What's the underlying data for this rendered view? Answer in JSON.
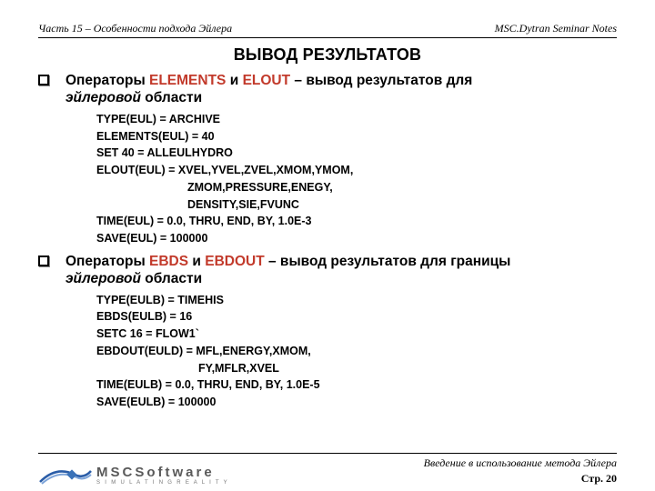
{
  "header": {
    "left": "Часть 15 – Особенности подхода Эйлера",
    "right": "MSC.Dytran Seminar Notes"
  },
  "title": "ВЫВОД РЕЗУЛЬТАТОВ",
  "section1": {
    "lead": "Операторы ",
    "kw1": "ELEMENTS",
    "mid": " и ",
    "kw2": "ELOUT",
    "tail1": " – вывод результатов для ",
    "tail2": "эйлеровой",
    "tail3": " области",
    "code": {
      "l1": "TYPE(EUL) = ARCHIVE",
      "l2": "ELEMENTS(EUL) = 40",
      "l3": "SET 40 = ALLEULHYDRO",
      "l4": "ELOUT(EUL) = XVEL,YVEL,ZVEL,XMOM,YMOM,",
      "l5": "ZMOM,PRESSURE,ENEGY,",
      "l6": "DENSITY,SIE,FVUNC",
      "l7": "TIME(EUL) = 0.0, THRU, END, BY, 1.0E-3",
      "l8": "SAVE(EUL) = 100000"
    }
  },
  "section2": {
    "lead": "Операторы ",
    "kw1": "EBDS",
    "mid": " и ",
    "kw2": "EBDOUT",
    "tail1": " – вывод результатов для границы ",
    "tail2": "эйлеровой",
    "tail3": " области",
    "code": {
      "l1": "TYPE(EULB) = TIMEHIS",
      "l2": "EBDS(EULB) = 16",
      "l3": "SETC 16 = FLOW1`",
      "l4": "EBDOUT(EULD) = MFL,ENERGY,XMOM,",
      "l5": "FY,MFLR,XVEL",
      "l6": "TIME(EULB) = 0.0, THRU, END, BY, 1.0E-5",
      "l7": "SAVE(EULB) = 100000"
    }
  },
  "footer": {
    "logo_main": "MSC",
    "logo_soft": "Software",
    "logo_tag": "S I M U L A T I N G   R E A L I T Y",
    "intro": "Введение в использование метода Эйлера",
    "page_label": "Стр. ",
    "page_num": "20"
  }
}
